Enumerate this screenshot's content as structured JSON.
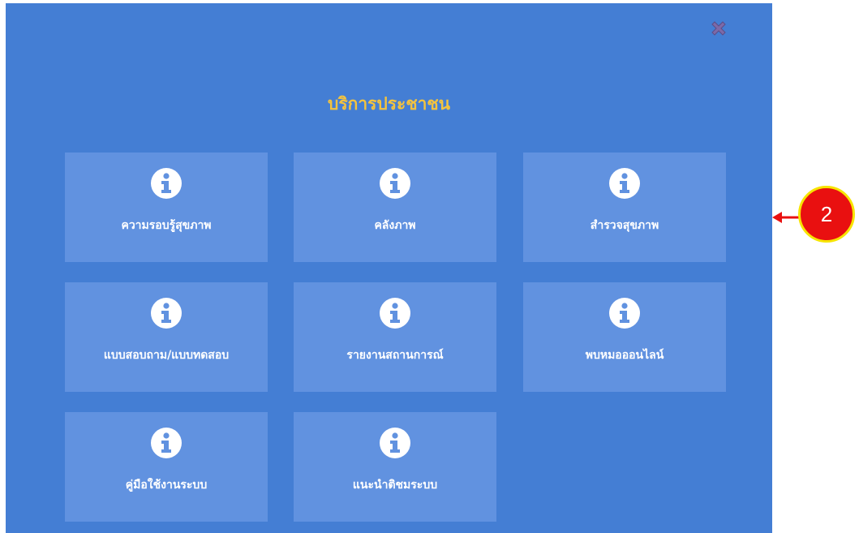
{
  "dialog": {
    "title": "บริการประชาชน",
    "close_icon": "close-x-icon",
    "tiles": [
      {
        "label": "ความรอบรู้สุขภาพ",
        "icon": "info-icon"
      },
      {
        "label": "คลังภาพ",
        "icon": "info-icon"
      },
      {
        "label": "สำรวจสุขภาพ",
        "icon": "info-icon"
      },
      {
        "label": "แบบสอบถาม/แบบทดสอบ",
        "icon": "info-icon"
      },
      {
        "label": "รายงานสถานการณ์",
        "icon": "info-icon"
      },
      {
        "label": "พบหมอออนไลน์",
        "icon": "info-icon"
      },
      {
        "label": "คู่มือใช้งานระบบ",
        "icon": "info-icon"
      },
      {
        "label": "แนะนำติชมระบบ",
        "icon": "info-icon"
      }
    ]
  },
  "annotation": {
    "callout_number": "2"
  },
  "colors": {
    "panel_bg": "#447ed4",
    "tile_bg": "#6192e0",
    "title_color": "#f3c33f",
    "callout_fill": "#e91010",
    "callout_border": "#f7e400"
  }
}
